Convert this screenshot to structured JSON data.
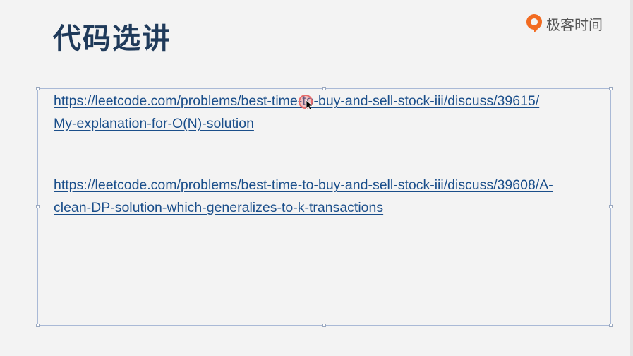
{
  "slide": {
    "title": "代码选讲"
  },
  "brand": {
    "name": "极客时间",
    "icon": "geektime-logo-icon",
    "color": "#f26b21"
  },
  "links": [
    {
      "line1": "https://leetcode.com/problems/best-time-to-buy-and-sell-stock-iii/discuss/39615/",
      "line2": "My-explanation-for-O(N)-solution"
    },
    {
      "line1": "https://leetcode.com/problems/best-time-to-buy-and-sell-stock-iii/discuss/39608/A-",
      "line2": "clean-DP-solution-which-generalizes-to-k-transactions"
    }
  ],
  "colors": {
    "title": "#1f3a5a",
    "link": "#1a4e8a",
    "cursor_highlight": "#e86a6a"
  }
}
